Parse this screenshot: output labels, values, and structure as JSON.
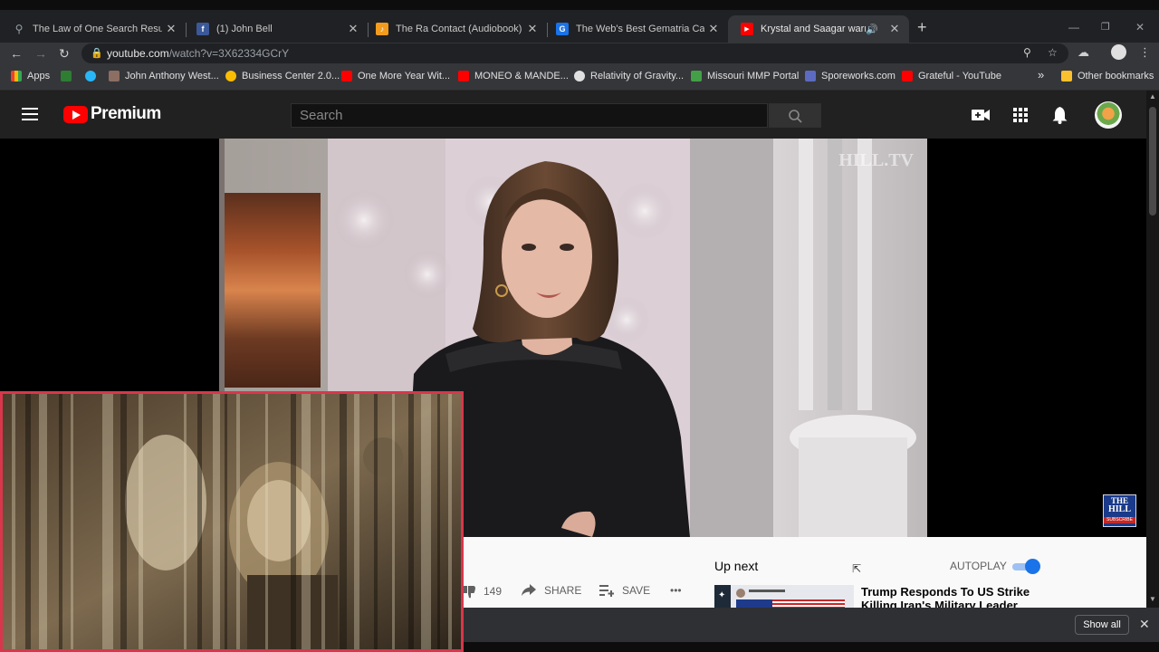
{
  "browser": {
    "tabs": [
      {
        "title": "The Law of One Search Results fo",
        "favicon_color": "#202124",
        "favicon_glyph": "⚲"
      },
      {
        "title": "(1) John Bell",
        "favicon_color": "#3b5998",
        "favicon_glyph": "f"
      },
      {
        "title": "The Ra Contact (Audiobook) by L",
        "favicon_color": "#f29b1d",
        "favicon_glyph": "♪"
      },
      {
        "title": "The Web's Best Gematria Calcula",
        "favicon_color": "#1a73e8",
        "favicon_glyph": "G"
      },
      {
        "title": "Krystal and Saagar warn Trun",
        "favicon_color": "#ff0000",
        "favicon_glyph": "▶"
      }
    ],
    "new_tab": "+",
    "url_host": "youtube.com",
    "url_path": "/watch?v=3X62334GCrY",
    "bookmarks": [
      {
        "label": "Apps",
        "color": "#1a73e8"
      },
      {
        "label": "",
        "color": "#2e7d32"
      },
      {
        "label": "",
        "color": "#29b6f6"
      },
      {
        "label": "John Anthony West...",
        "color": "#8d6e63"
      },
      {
        "label": "Business Center 2.0...",
        "color": "#fbbc04"
      },
      {
        "label": "One More Year Wit...",
        "color": "#ff0000"
      },
      {
        "label": "MONEO & MANDE...",
        "color": "#ff0000"
      },
      {
        "label": "Relativity of Gravity...",
        "color": "#e0e0e0"
      },
      {
        "label": "Missouri MMP Portal",
        "color": "#43a047"
      },
      {
        "label": "Sporeworks.com",
        "color": "#5c6bc0"
      },
      {
        "label": "Grateful - YouTube",
        "color": "#ff0000"
      }
    ],
    "overflow": "»",
    "other_bookmarks": "Other bookmarks"
  },
  "youtube": {
    "brand": "Premium",
    "search_placeholder": "Search"
  },
  "video": {
    "watermark": "HILL.TV",
    "badge_line1": "THE",
    "badge_line2": "HILL",
    "badge_line3": "SUBSCRIBE"
  },
  "below_video": {
    "dislike_count": "149",
    "share_label": "SHARE",
    "save_label": "SAVE",
    "more_label": "•••",
    "up_next_label": "Up next",
    "autoplay_label": "AUTOPLAY",
    "autoplay_on": true,
    "next_video_title_line1": "Trump Responds To US Strike",
    "next_video_title_line2": "Killing Iran's Military Leader"
  },
  "download_bar": {
    "show_all_label": "Show all",
    "close_glyph": "✕"
  },
  "colors": {
    "youtube_red": "#ff0000",
    "pip_border": "#d9364c",
    "toggle_blue": "#1a73e8",
    "masthead": "#212121"
  }
}
